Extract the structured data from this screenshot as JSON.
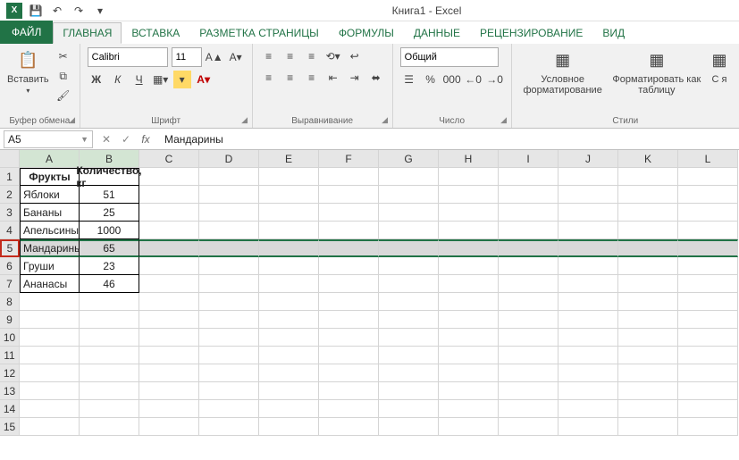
{
  "titlebar": {
    "title": "Книга1 - Excel"
  },
  "tabs": {
    "file": "ФАЙЛ",
    "items": [
      "ГЛАВНАЯ",
      "ВСТАВКА",
      "РАЗМЕТКА СТРАНИЦЫ",
      "ФОРМУЛЫ",
      "ДАННЫЕ",
      "РЕЦЕНЗИРОВАНИЕ",
      "ВИД"
    ],
    "active": "ГЛАВНАЯ"
  },
  "ribbon": {
    "clipboard": {
      "paste": "Вставить",
      "glyph_paste": "📋",
      "glyph_cut": "✂",
      "glyph_copy": "⧉",
      "glyph_fmt": "🖌",
      "label": "Буфер обмена"
    },
    "font": {
      "name": "Calibri",
      "size": "11",
      "bold": "Ж",
      "italic": "К",
      "underline": "Ч",
      "grow": "A▲",
      "shrink": "A▾",
      "label": "Шрифт"
    },
    "alignment": {
      "label": "Выравнивание",
      "wrap": "↩",
      "merge": "⬌"
    },
    "number": {
      "format": "Общий",
      "label": "Число",
      "currency": "☰",
      "percent": "%",
      "thousands": "000",
      "inc": "←0",
      "dec": "→0"
    },
    "styles": {
      "cond": {
        "icon": "▦",
        "label": "Условное форматирование"
      },
      "table": {
        "icon": "▦",
        "label": "Форматировать как таблицу"
      },
      "cell": {
        "icon": "▦",
        "label": "С я"
      },
      "label": "Стили"
    }
  },
  "formula_bar": {
    "name_box": "A5",
    "fx": "fx",
    "value": "Мандарины"
  },
  "grid": {
    "columns": [
      "A",
      "B",
      "C",
      "D",
      "E",
      "F",
      "G",
      "H",
      "I",
      "J",
      "K",
      "L"
    ],
    "row_count": 15,
    "selected_row": 5,
    "headers": [
      "Фрукты",
      "Количество, кг"
    ],
    "rows": [
      {
        "a": "Яблоки",
        "b": "51"
      },
      {
        "a": "Бананы",
        "b": "25"
      },
      {
        "a": "Апельсины",
        "b": "1000"
      },
      {
        "a": "Мандарины",
        "b": "65"
      },
      {
        "a": "Груши",
        "b": "23"
      },
      {
        "a": "Ананасы",
        "b": "46"
      }
    ]
  },
  "chart_data": {
    "type": "table",
    "title": "Количество, кг",
    "categories": [
      "Яблоки",
      "Бананы",
      "Апельсины",
      "Мандарины",
      "Груши",
      "Ананасы"
    ],
    "values": [
      51,
      25,
      1000,
      65,
      23,
      46
    ]
  }
}
